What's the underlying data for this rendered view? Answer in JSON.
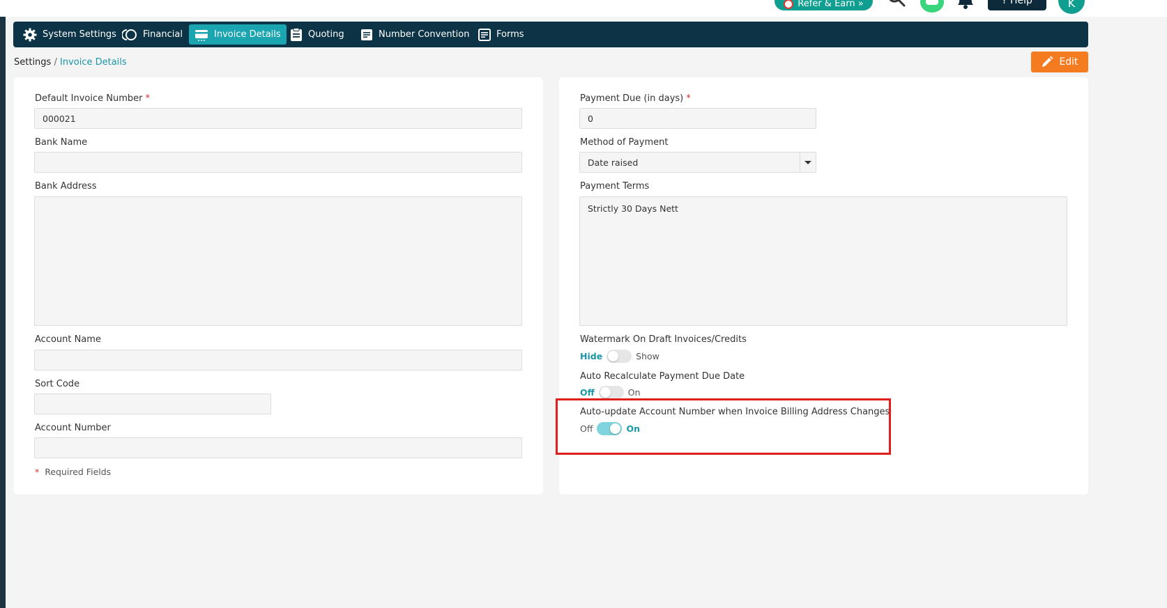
{
  "topbar": {
    "refer_label": "Refer & Earn »",
    "help_label": "? Help",
    "avatar_initial": "K"
  },
  "nav": {
    "items": [
      {
        "label": "System Settings",
        "icon": "gear-icon"
      },
      {
        "label": "Financial",
        "icon": "financial-icon"
      },
      {
        "label": "Invoice Details",
        "icon": "invoice-card-icon",
        "active": true
      },
      {
        "label": "Quoting",
        "icon": "clipboard-icon"
      },
      {
        "label": "Number Convention",
        "icon": "document-icon"
      },
      {
        "label": "Forms",
        "icon": "forms-icon"
      }
    ]
  },
  "breadcrumb": {
    "root": "Settings",
    "separator": " / ",
    "current": "Invoice Details"
  },
  "edit_label": "Edit",
  "left": {
    "default_invoice_number": {
      "label": "Default Invoice Number",
      "value": "000021"
    },
    "bank_name": {
      "label": "Bank Name",
      "value": ""
    },
    "bank_address": {
      "label": "Bank Address",
      "value": ""
    },
    "account_name": {
      "label": "Account Name",
      "value": ""
    },
    "sort_code": {
      "label": "Sort Code",
      "value": ""
    },
    "account_number": {
      "label": "Account Number",
      "value": ""
    },
    "required_note": "Required Fields"
  },
  "right": {
    "payment_due": {
      "label": "Payment Due (in days)",
      "value": "0"
    },
    "method_of_payment": {
      "label": "Method of Payment",
      "value": "Date raised"
    },
    "payment_terms": {
      "label": "Payment Terms",
      "value": "Strictly 30 Days Nett"
    },
    "watermark": {
      "label": "Watermark On Draft Invoices/Credits",
      "off": "Hide",
      "on": "Show",
      "state": "off"
    },
    "auto_recalc": {
      "label": "Auto Recalculate Payment Due Date",
      "off": "Off",
      "on": "On",
      "state": "off"
    },
    "auto_update": {
      "label": "Auto-update Account Number when Invoice Billing Address Changes",
      "off": "Off",
      "on": "On",
      "state": "on"
    }
  },
  "required_marker": "*",
  "colors": {
    "nav_bg": "#0d3446",
    "accent": "#1aa5b0",
    "edit_button": "#f47b20",
    "highlight": "#e01e1e"
  }
}
